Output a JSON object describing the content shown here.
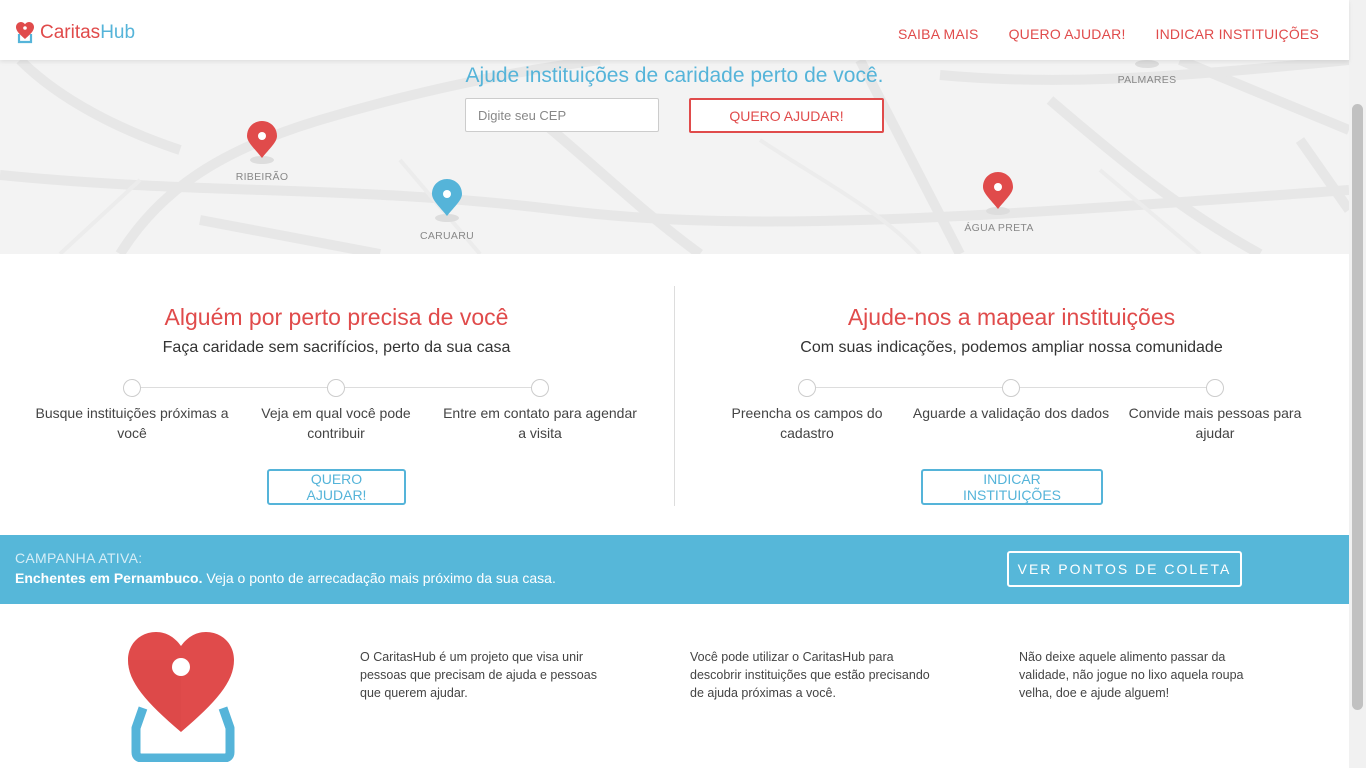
{
  "navbar": {
    "brand_part1": "Caritas",
    "brand_part2": "Hub",
    "links": [
      "SAIBA MAIS",
      "QUERO AJUDAR!",
      "INDICAR INSTITUIÇÕES"
    ]
  },
  "hero": {
    "title": "Ajude instituições de caridade perto de você.",
    "cep_placeholder": "Digite seu CEP",
    "button_label": "QUERO AJUDAR!",
    "places": [
      "RIBEIRÃO",
      "CARUARU",
      "ÁGUA PRETA",
      "PALMARES"
    ]
  },
  "left_section": {
    "title": "Alguém por perto precisa de você",
    "subtitle": "Faça caridade sem sacrifícios, perto da sua casa",
    "steps": [
      "Busque instituições próximas a você",
      "Veja em qual você pode contribuir",
      "Entre em contato para agendar a visita"
    ],
    "button_label": "QUERO AJUDAR!"
  },
  "right_section": {
    "title": "Ajude-nos a mapear instituições",
    "subtitle": "Com suas indicações, podemos ampliar nossa comunidade",
    "steps": [
      "Preencha os campos do cadastro",
      "Aguarde a validação dos dados",
      "Convide mais pessoas para ajudar"
    ],
    "button_label": "INDICAR INSTITUIÇÕES"
  },
  "campaign": {
    "label": "CAMPANHA ATIVA:",
    "headline": "Enchentes em Pernambuco.",
    "text": " Veja o ponto de arrecadação mais próximo da sua casa.",
    "button_label": "VER PONTOS DE COLETA"
  },
  "footer": {
    "texts": [
      "O CaritasHub é um projeto que visa unir pessoas que precisam de ajuda e pessoas que querem ajudar.",
      "Você pode utilizar o CaritasHub para descobrir instituições que estão precisando de ajuda próximas a você.",
      "Não deixe aquele alimento passar da validade, não jogue no lixo aquela roupa velha, doe e ajude alguem!"
    ]
  },
  "colors": {
    "brand_red": "#e04b4b",
    "brand_blue": "#55b4d9"
  }
}
